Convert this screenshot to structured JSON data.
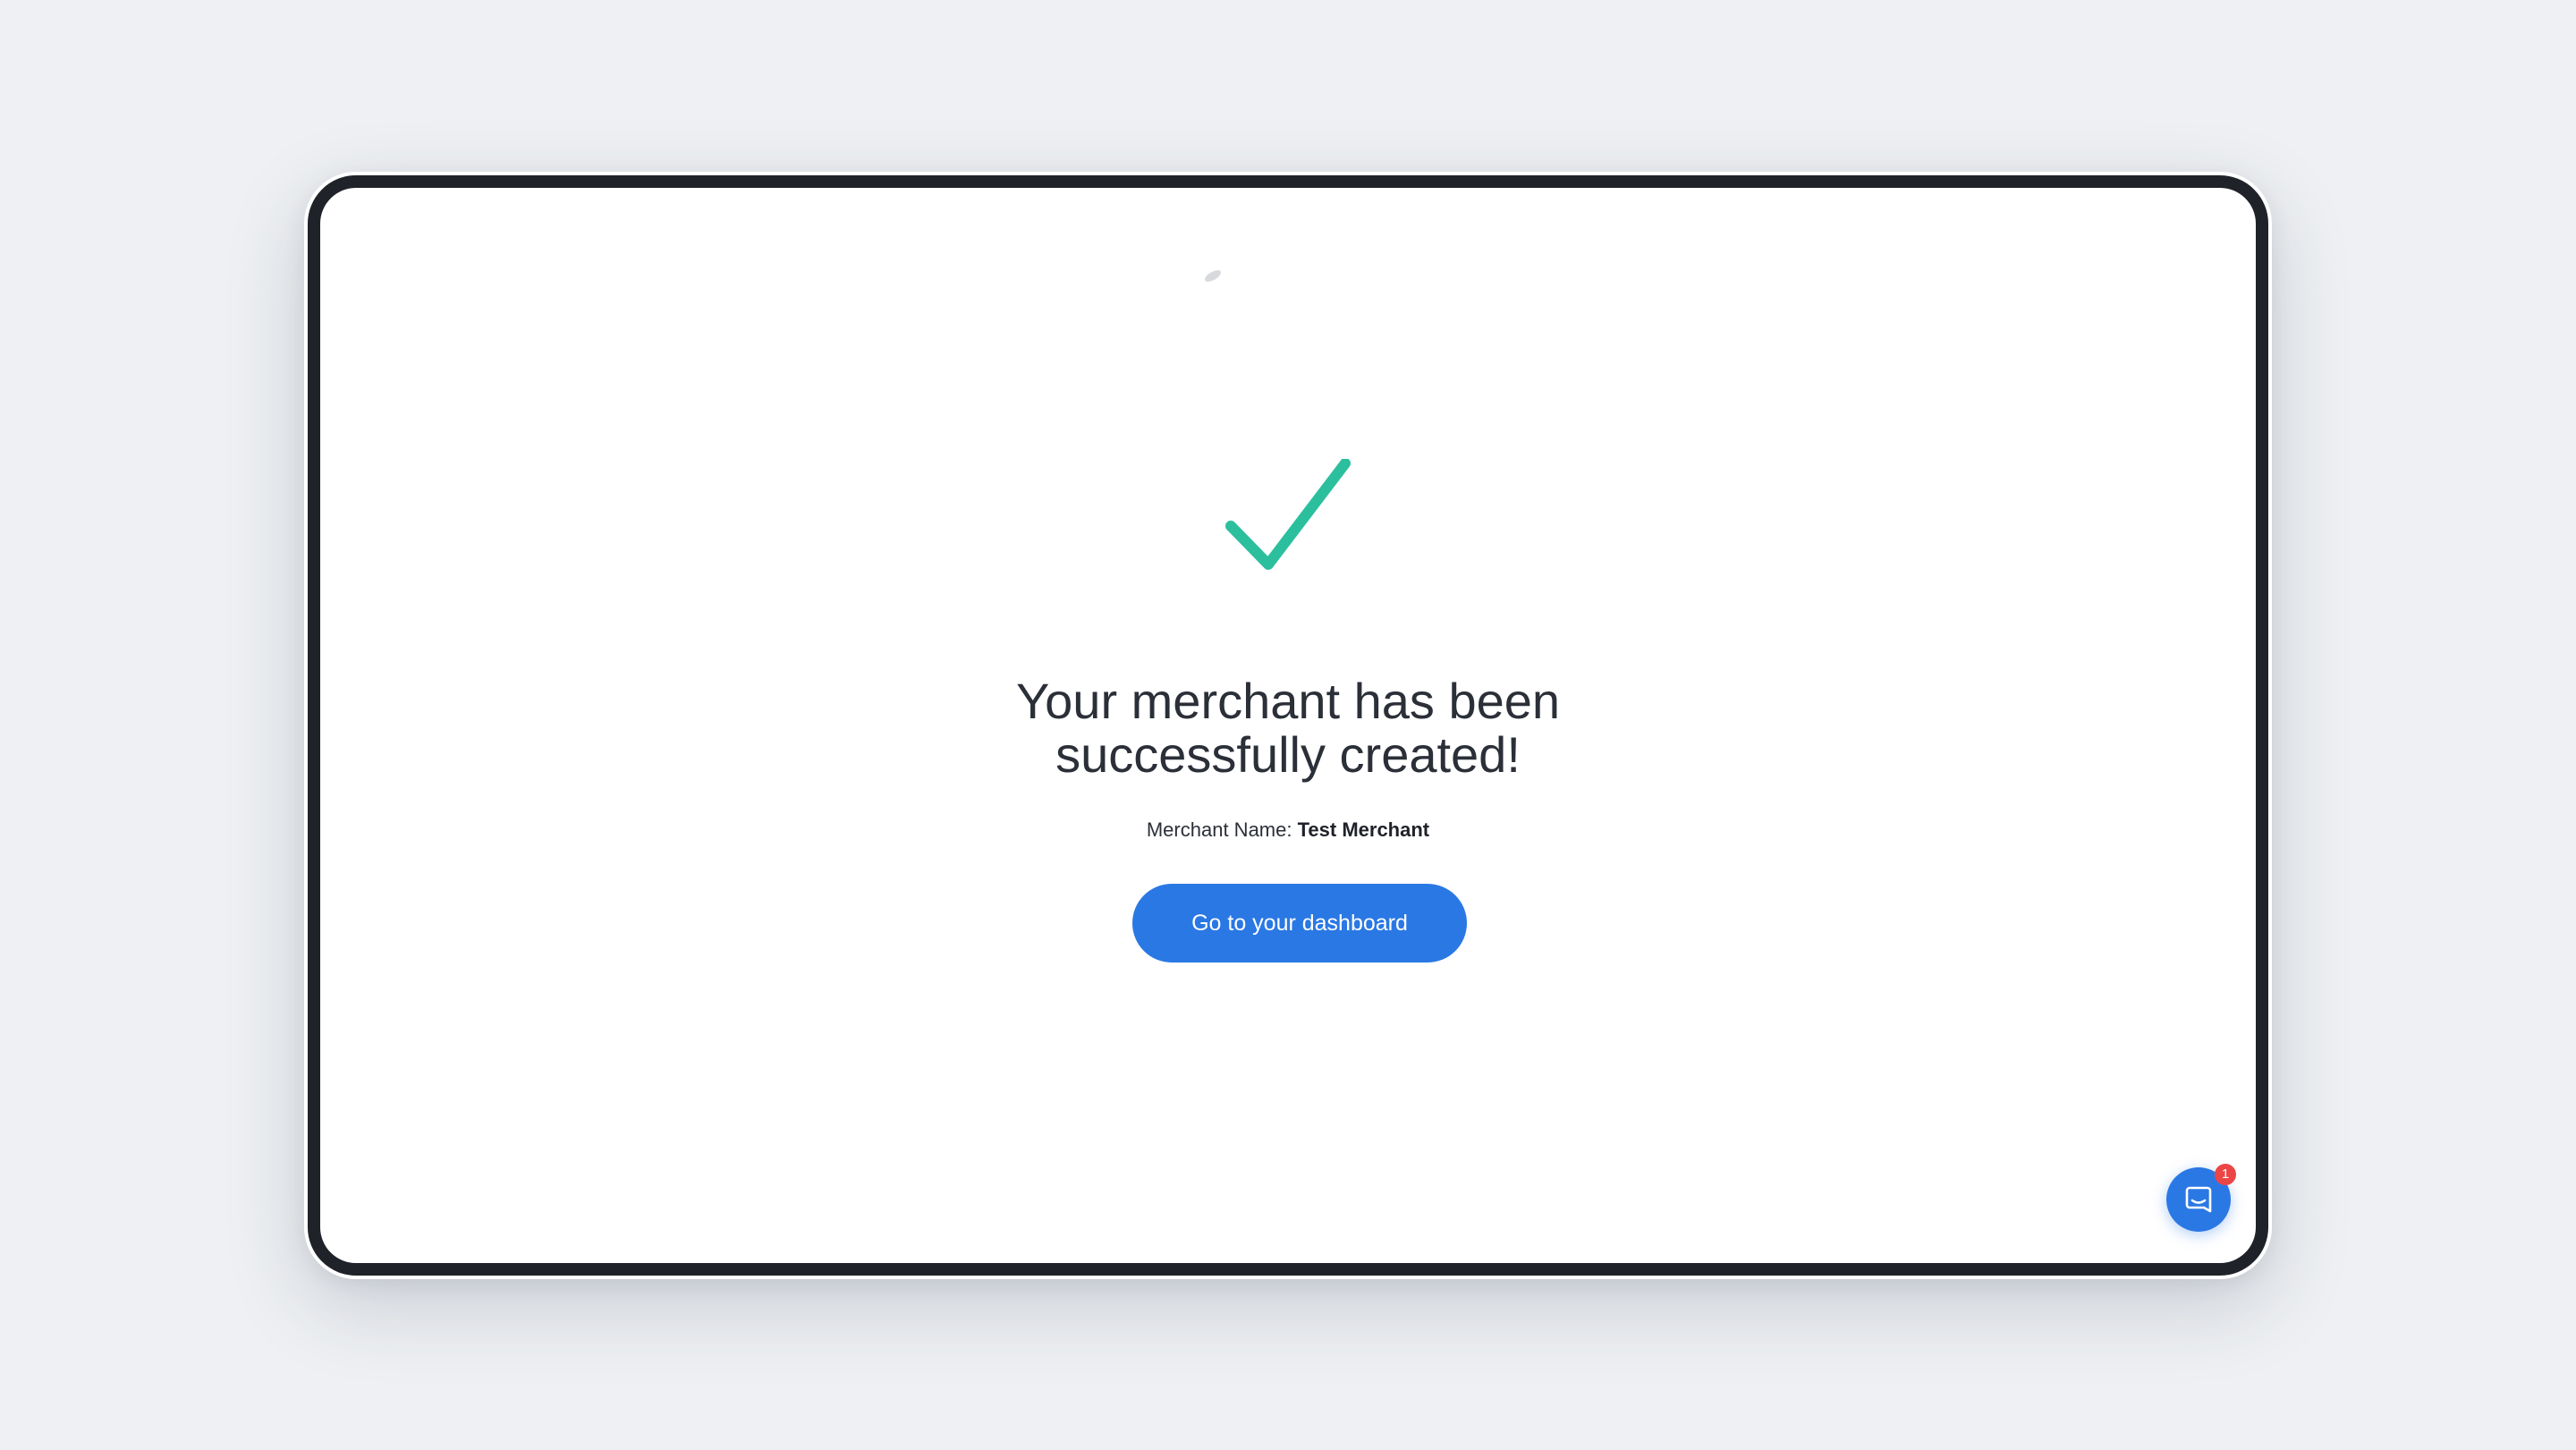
{
  "success": {
    "icon": "checkmark-icon",
    "accent_color": "#2bbf9e",
    "headline_line1": "Your merchant has been",
    "headline_line2": "successfully created!",
    "merchant_name_label": "Merchant Name:",
    "merchant_name_value": "Test Merchant",
    "button_label": "Go to your dashboard",
    "button_color": "#2a78e4"
  },
  "chat": {
    "icon": "chat-bubble-icon",
    "badge_count": "1",
    "badge_color": "#ec4545"
  }
}
